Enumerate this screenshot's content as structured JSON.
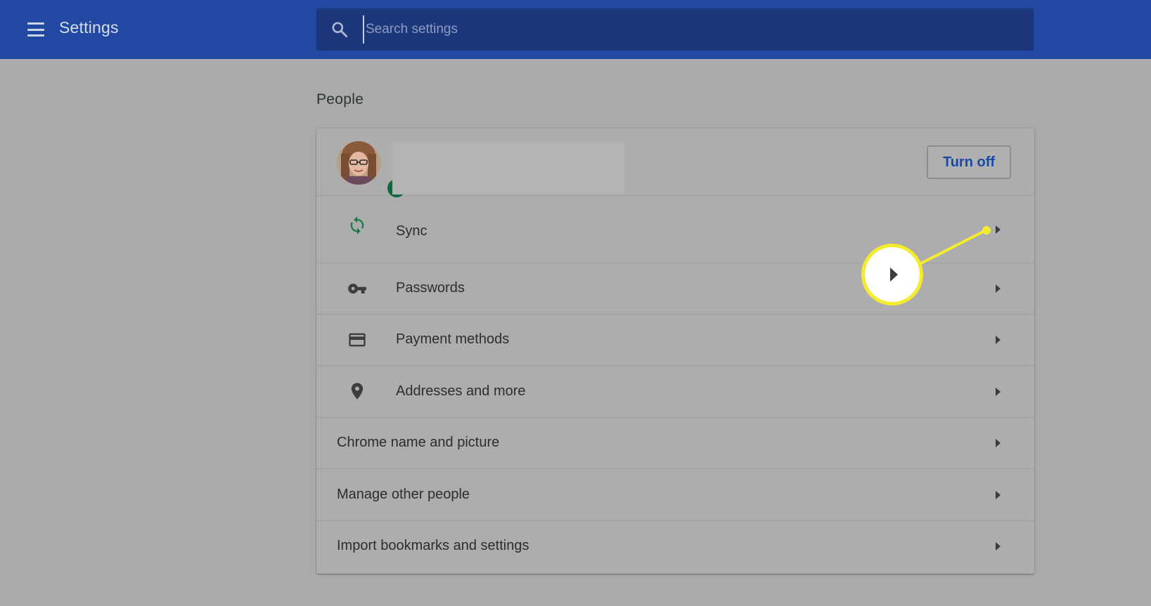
{
  "header": {
    "title": "Settings",
    "search_placeholder": "Search settings",
    "search_value": "",
    "menu_icon": "hamburger-menu-icon",
    "search_icon": "magnifier-icon"
  },
  "section": {
    "title": "People"
  },
  "profile": {
    "avatar": "user-avatar",
    "badge_icon": "sync-icon",
    "turn_off_label": "Turn off"
  },
  "rows": [
    {
      "label": "Sync",
      "icon": "sync-icon"
    },
    {
      "label": "Passwords",
      "icon": "key-icon"
    },
    {
      "label": "Payment methods",
      "icon": "credit-card-icon"
    },
    {
      "label": "Addresses and more",
      "icon": "location-pin-icon"
    },
    {
      "label": "Chrome name and picture",
      "icon": ""
    },
    {
      "label": "Manage other people",
      "icon": ""
    },
    {
      "label": "Import bookmarks and settings",
      "icon": ""
    }
  ],
  "callout": {
    "icon": "chevron-right-icon",
    "color": "#f4ea2e"
  },
  "colors": {
    "header_bg": "#2249a1",
    "search_bg": "#1c377b",
    "page_bg": "#a9abab",
    "accent_blue": "#1a4aa8",
    "sync_green": "#0f6a3b"
  }
}
